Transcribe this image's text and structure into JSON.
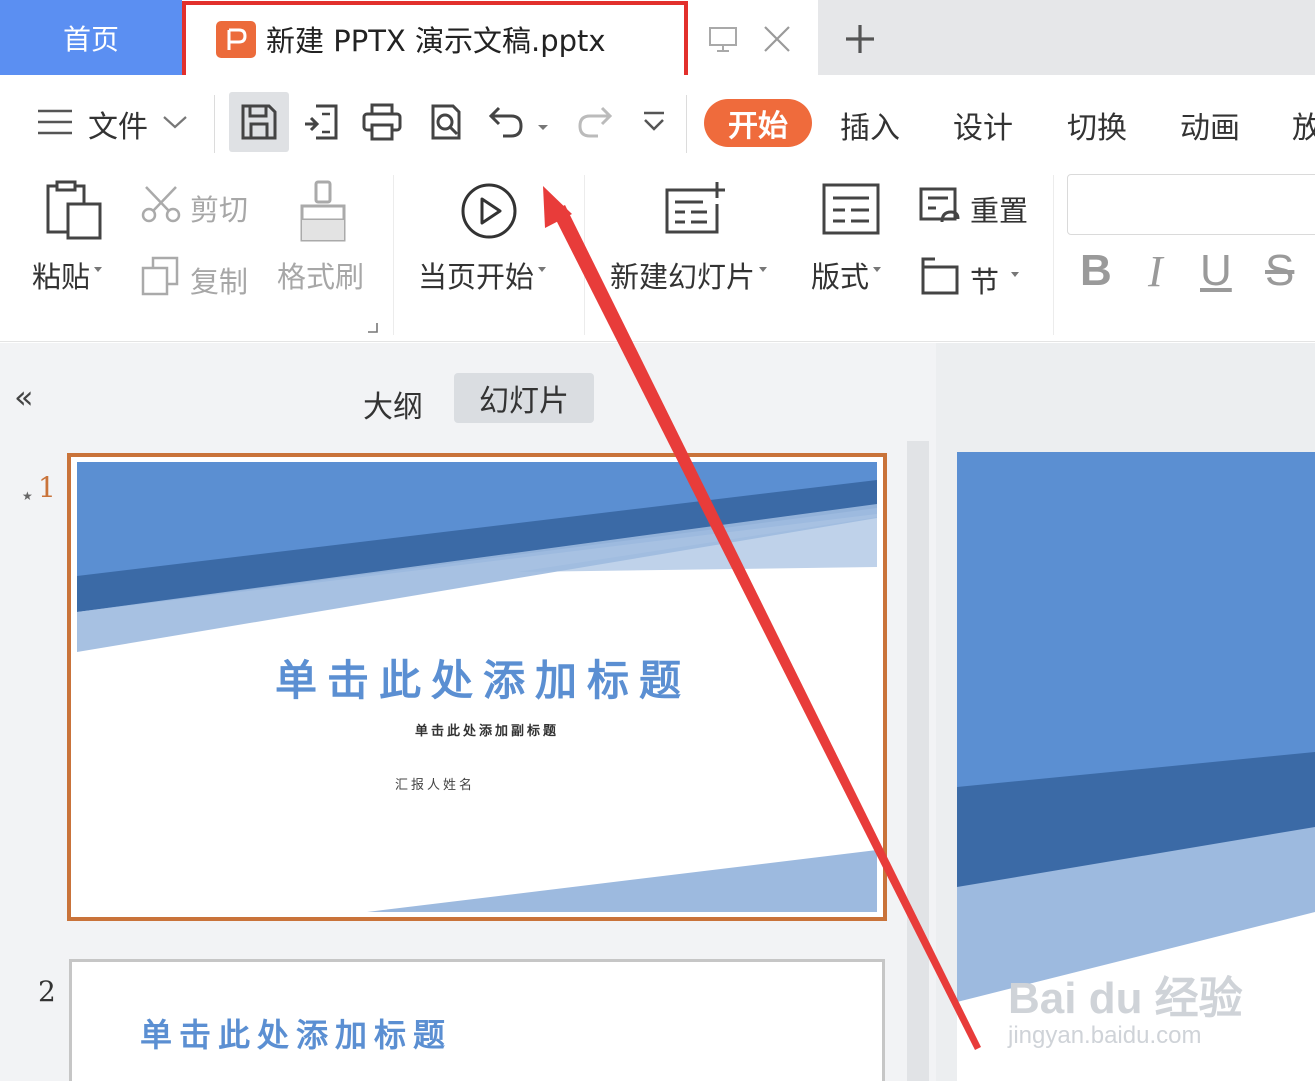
{
  "tabs": {
    "home": "首页",
    "document": "新建 PPTX 演示文稿.pptx"
  },
  "menu": {
    "file": "文件",
    "tabs": [
      "开始",
      "插入",
      "设计",
      "切换",
      "动画",
      "放"
    ]
  },
  "ribbon": {
    "paste": "粘贴",
    "cut": "剪切",
    "copy": "复制",
    "format_painter": "格式刷",
    "play_from_current": "当页开始",
    "new_slide": "新建幻灯片",
    "layout": "版式",
    "reset": "重置",
    "section": "节",
    "bold": "B",
    "italic": "I",
    "underline": "U",
    "strike": "S"
  },
  "left_pane": {
    "collapse": "«",
    "tab_outline": "大纲",
    "tab_slides": "幻灯片"
  },
  "slides": [
    {
      "number": "1",
      "title": "单击此处添加标题",
      "subtitle": "单击此处添加副标题",
      "author": "汇报人姓名"
    },
    {
      "number": "2",
      "title": "单击此处添加标题"
    }
  ],
  "watermark": {
    "brand": "Bai du 经验",
    "url": "jingyan.baidu.com"
  },
  "colors": {
    "home_tab": "#5b8ff2",
    "active_tab": "#ef6b3c",
    "highlight_frame": "#e2302c",
    "selected_slide_border": "#c9733a",
    "slide_blue": "#5b8fd2",
    "slide_dark_blue": "#3b6aa6",
    "slide_light_blue": "#9dbadf"
  }
}
